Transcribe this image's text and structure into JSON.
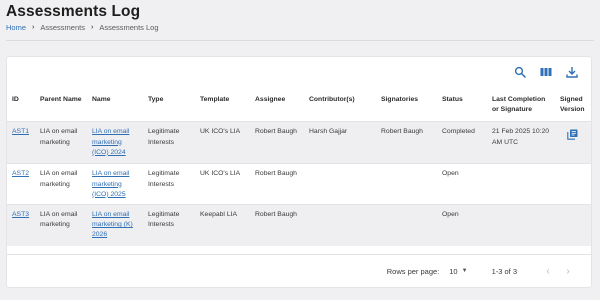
{
  "page": {
    "title": "Assessments Log"
  },
  "breadcrumb": {
    "items": [
      "Home",
      "Assessments",
      "Assessments Log"
    ]
  },
  "toolbar": {
    "icons": [
      "search-icon",
      "columns-icon",
      "download-icon"
    ],
    "accent": "#2f6fb5"
  },
  "table": {
    "headers": {
      "id": "ID",
      "parent_name": "Parent Name",
      "name": "Name",
      "type": "Type",
      "template": "Template",
      "assignee": "Assignee",
      "contributors": "Contributor(s)",
      "signatories": "Signatories",
      "status": "Status",
      "last": "Last Completion or Signature",
      "version": "Signed Version"
    },
    "rows": [
      {
        "id": "AST1",
        "parent_name": "LIA on email marketing",
        "name": "LIA on email marketing (ICO) 2024",
        "type": "Legitimate Interests",
        "template": "UK ICO's LIA",
        "assignee": "Robert Baugh",
        "contributors": "Harsh Gajjar",
        "signatories": "Robert Baugh",
        "status": "Completed",
        "last": "21 Feb 2025 10:20 AM UTC",
        "version": "document-version-icon"
      },
      {
        "id": "AST2",
        "parent_name": "LIA on email marketing",
        "name": "LIA on email marketing (ICO) 2025",
        "type": "Legitimate Interests",
        "template": "UK ICO's LIA",
        "assignee": "Robert Baugh",
        "contributors": "",
        "signatories": "",
        "status": "Open",
        "last": "",
        "version": ""
      },
      {
        "id": "AST3",
        "parent_name": "LIA on email marketing",
        "name": "LIA on email marketing (K) 2026",
        "type": "Legitimate Interests",
        "template": "Keepabl LIA",
        "assignee": "Robert Baugh",
        "contributors": "",
        "signatories": "",
        "status": "Open",
        "last": "",
        "version": ""
      }
    ]
  },
  "pagination": {
    "rows_per_page_label": "Rows per page:",
    "rows_per_page_value": "10",
    "range_text": "1-3 of 3"
  }
}
